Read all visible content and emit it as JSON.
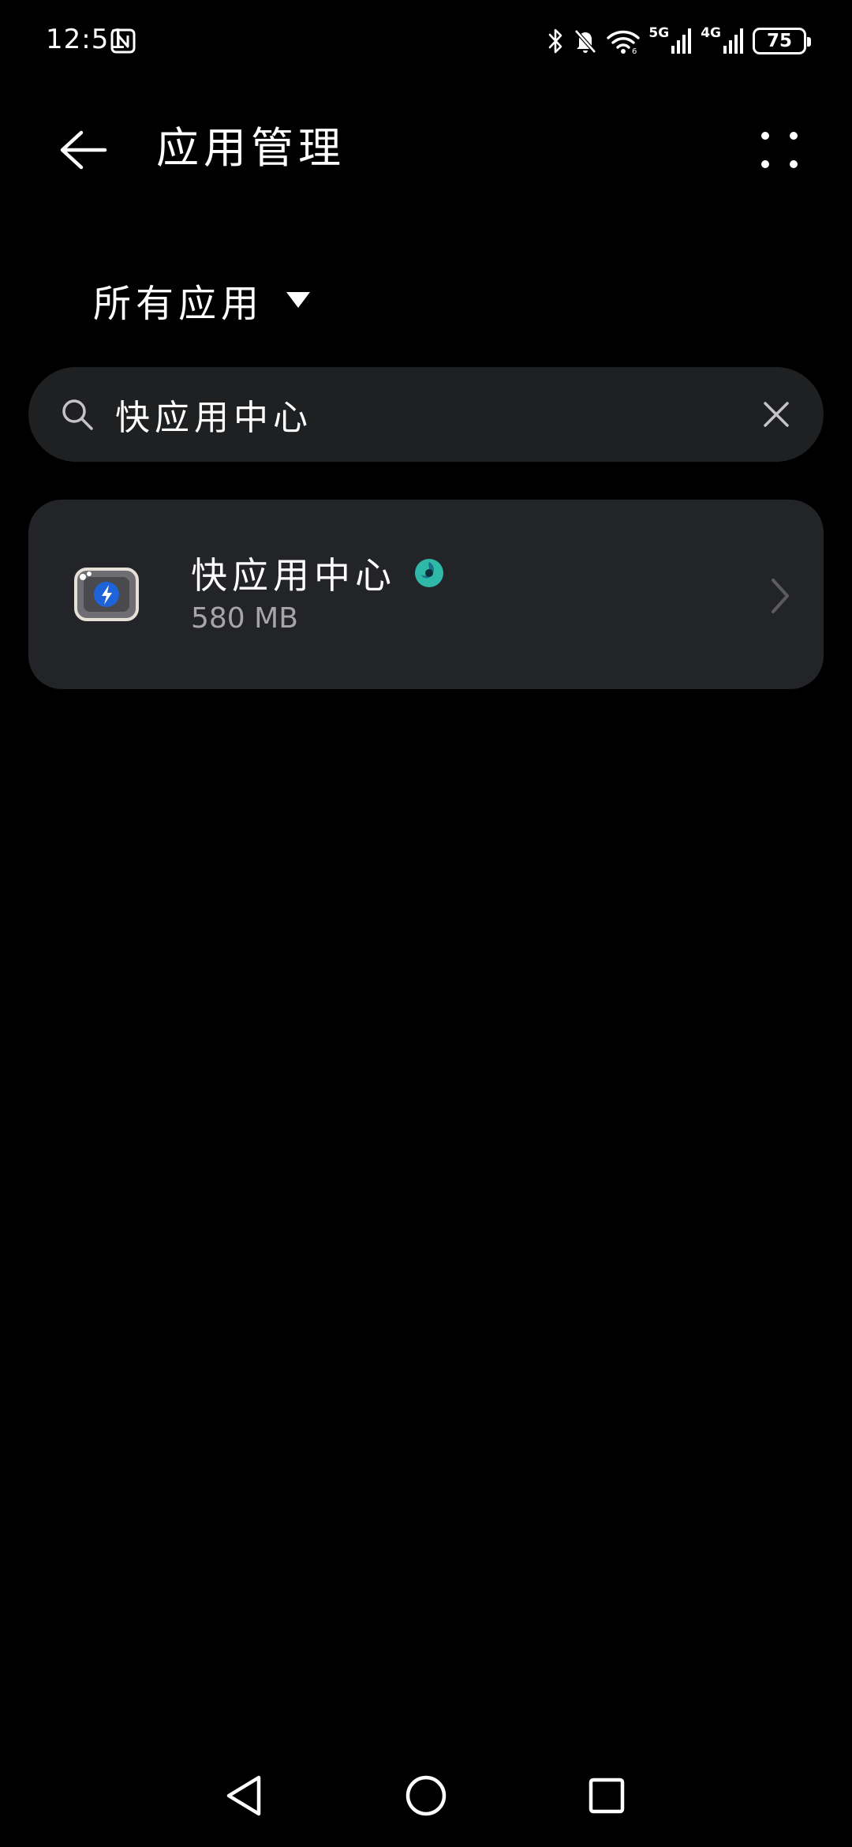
{
  "status_bar": {
    "time": "12:51",
    "network_5g": "5G",
    "network_4g": "4G",
    "battery_level": "75",
    "icons": [
      "nfc-icon",
      "bluetooth-icon",
      "bell-off-icon",
      "wifi-icon",
      "signal-icon",
      "battery-icon"
    ]
  },
  "header": {
    "title": "应用管理",
    "back_icon": "arrow-left-icon",
    "more_icon": "more-dots-icon"
  },
  "filter": {
    "label": "所有应用",
    "icon": "triangle-down-icon"
  },
  "search": {
    "value": "快应用中心",
    "icon": "search-icon",
    "clear_icon": "close-icon"
  },
  "app_list": [
    {
      "name": "快应用中心",
      "size": "580 MB",
      "icon": "quick-app-center-icon",
      "badge_icon": "security-badge-icon"
    }
  ],
  "nav_bar": {
    "icons": [
      "nav-back-icon",
      "nav-home-icon",
      "nav-recents-icon"
    ]
  },
  "colors": {
    "background": "#000000",
    "surface": "#1f2022",
    "card": "#232427",
    "secondary_text": "#a6a6aa",
    "badge_teal": "#2fb7a8"
  }
}
